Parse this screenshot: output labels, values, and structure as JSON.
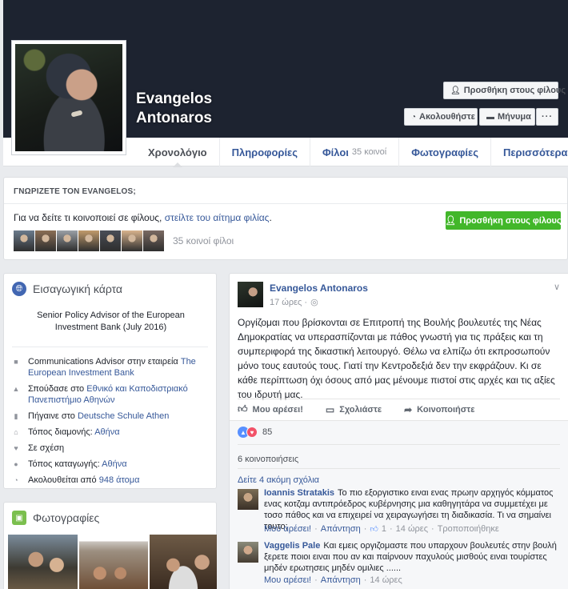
{
  "profile": {
    "name": "Evangelos Antonaros",
    "add_friend_label": "Προσθήκη στους φίλους",
    "follow_label": "Ακολουθήστε",
    "message_label": "Μήνυμα",
    "more_label": "···"
  },
  "tabs": [
    {
      "label": "Χρονολόγιο"
    },
    {
      "label": "Πληροφορίες"
    },
    {
      "label": "Φίλοι",
      "count": "35 κοινοί"
    },
    {
      "label": "Φωτογραφίες"
    },
    {
      "label": "Περισσότερα"
    }
  ],
  "know_card": {
    "title": "ΓΝΩΡΙΖΕΤΕ ΤΟΝ EVANGELOS;",
    "text": "Για να δείτε τι κοινοποιεί σε φίλους, ",
    "link": "στείλτε του αίτημα φιλίας",
    "text_end": ".",
    "button": "Προσθήκη στους φίλους",
    "mutual_count": "35 κοινοί φίλοι",
    "mutual_colors": [
      "#6b7b8c",
      "#8a6e55",
      "#9aa0a6",
      "#c19a6b",
      "#4a4e57",
      "#d8b38d",
      "#7a6a62",
      "#aeb3b9",
      "#5c6470"
    ]
  },
  "intro": {
    "title": "Εισαγωγική κάρτα",
    "bio": "Senior Policy Advisor of the European Investment Bank (July 2016)",
    "items": [
      {
        "icon": "briefcase-icon",
        "text": "Communications Advisor στην εταιρεία ",
        "link": "The European Investment Bank"
      },
      {
        "icon": "graduation-cap-icon",
        "text": "Σπούδασε στο ",
        "link": "Εθνικό και Καποδιστριακό Πανεπιστήμιο Αθηνών"
      },
      {
        "icon": "school-icon",
        "text": "Πήγαινε στο ",
        "link": "Deutsche Schule Athen"
      },
      {
        "icon": "home-icon",
        "text": "Τόπος διαμονής: ",
        "link": "Αθήνα"
      },
      {
        "icon": "heart-icon",
        "text": "Σε σχέση",
        "link": ""
      },
      {
        "icon": "location-pin-icon",
        "text": "Τόπος καταγωγής: ",
        "link": "Αθήνα"
      },
      {
        "icon": "rss-icon",
        "text": "Ακολουθείται από ",
        "link": "948 άτομα"
      }
    ]
  },
  "photos": {
    "title": "Φωτογραφίες"
  },
  "post": {
    "author": "Evangelos Antonaros",
    "time": "17 ώρες ·",
    "text": "Οργίζομαι που βρίσκονται σε Επιτροπή της Βουλής βουλευτές της Νέας Δημοκρατίας να υπερασπίζονται με πάθος γνωστή για τις πράξεις και τη συμπεριφορά της δικαστική λειτουργό. Θέλω να ελπίζω ότι εκπροσωπούν μόνο τους εαυτούς τους. Γιατί την Κεντροδεξιά δεν την εκφράζουν. Κι σε κάθε περίπτωση όχι όσους από μας μένουμε πιστοί στις αρχές και τις αξίες του ιδρυτή μας.",
    "like_label": "Μου αρέσει!",
    "comment_label": "Σχολιάστε",
    "share_label": "Κοινοποιήστε",
    "reactions_count": "85",
    "shares": "6 κοινοποιήσεις",
    "more_comments": "Δείτε 4 ακόμη σχόλια"
  },
  "comments": [
    {
      "name": "Ioannis Stratakis",
      "text": "Το πιο εξοργιστικο ειναι ενας πρωην αρχηγός κόμματος ενας κοτζαμ αντιπρόεδρος κυβέρνησης μια καθηγητάρα να συμμετέχει με τοσο πάθος και να επιχειρεί να χειραγωγήσει τη διαδικασία. Τι να σημαίνει τουτο;",
      "like": "Μου αρέσει!",
      "reply": "Απάντηση",
      "likes": "1",
      "time": "14 ώρες",
      "edited": "Τροποποιήθηκε"
    },
    {
      "name": "Vaggelis Pale",
      "text": "Και εμεις οργιζομαστε που υπαρχουν βουλευτές στην βουλή ξερετε ποιοι ειναι που αν και παίρνουν παχυλούς μισθούς ειναι τουρίστες μηδέν ερωτησεις μηδέν ομιλιες ......",
      "like": "Μου αρέσει!",
      "reply": "Απάντηση",
      "time": "14 ώρες"
    }
  ]
}
